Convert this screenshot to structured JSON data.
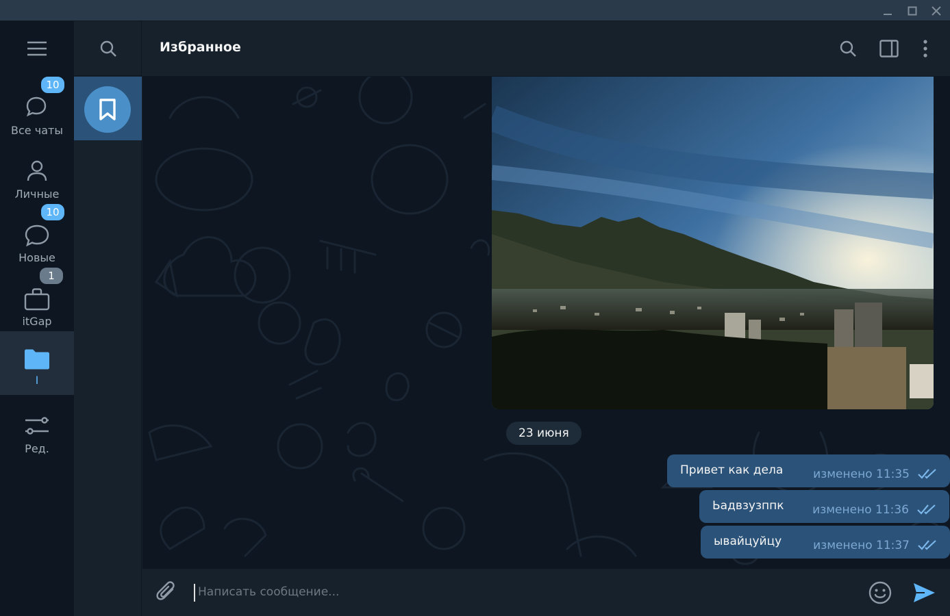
{
  "window": {
    "controls": [
      "minimize-icon",
      "maximize-icon",
      "close-icon"
    ]
  },
  "folders": [
    {
      "label": "Все чаты",
      "icon": "chats-icon",
      "badge": "10",
      "badge_muted": false,
      "active": false
    },
    {
      "label": "Личные",
      "icon": "person-icon",
      "badge": "",
      "badge_muted": false,
      "active": false
    },
    {
      "label": "Новые",
      "icon": "chat-bubble-icon",
      "badge": "10",
      "badge_muted": false,
      "active": false
    },
    {
      "label": "itGap",
      "icon": "briefcase-icon",
      "badge": "1",
      "badge_muted": true,
      "active": false
    },
    {
      "label": "I",
      "icon": "folder-icon",
      "badge": "",
      "badge_muted": false,
      "active": true
    },
    {
      "label": "Ред.",
      "icon": "sliders-icon",
      "badge": "",
      "badge_muted": false,
      "active": false
    }
  ],
  "chat": {
    "title": "Избранное",
    "avatar_icon": "bookmark-icon",
    "date_chip": "23 июня",
    "messages": [
      {
        "text": "Привет как дела",
        "meta": "изменено 11:35",
        "status": "read"
      },
      {
        "text": "Ьадвзузппк",
        "meta": "изменено 11:36",
        "status": "read"
      },
      {
        "text": "ывайцуйцу",
        "meta": "изменено 11:37",
        "status": "read"
      }
    ]
  },
  "composer": {
    "placeholder": "Написать сообщение..."
  },
  "colors": {
    "accent": "#5eb5f7",
    "bubble_out": "#2b5278",
    "background": "#0e1621",
    "panel": "#17212b"
  }
}
